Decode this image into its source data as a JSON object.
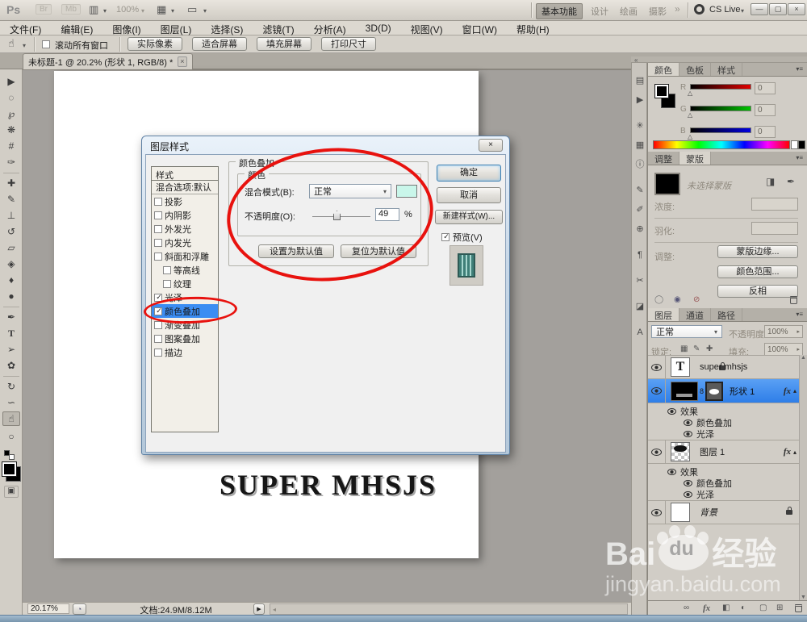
{
  "colors": {
    "ui_background": "#d6d2ca",
    "canvas_background": "#a3a09c",
    "selection_blue": "#2f7ee8",
    "annotation_red": "#e8120e",
    "overlay_swatch": "#c9f6ea"
  },
  "app_bar": {
    "logo": "Ps",
    "bridge": "Br",
    "mini_bridge": "Mb",
    "layout_glyph": "▥",
    "zoom_level": "100%",
    "view_glyph": "▦",
    "screen_glyph": "▭",
    "arrow": "▾",
    "workspaces": [
      "基本功能",
      "设计",
      "绘画",
      "摄影"
    ],
    "overflow": "»",
    "cs_live_label": "CS Live",
    "window_min": "—",
    "window_restore": "▢",
    "window_close": "×"
  },
  "menu_bar": {
    "items": [
      "文件(F)",
      "编辑(E)",
      "图像(I)",
      "图层(L)",
      "选择(S)",
      "滤镜(T)",
      "分析(A)",
      "3D(D)",
      "视图(V)",
      "窗口(W)",
      "帮助(H)"
    ]
  },
  "options_bar": {
    "tool_glyph": "☝",
    "scroll_all_label": "滚动所有窗口",
    "buttons": [
      "实际像素",
      "适合屏幕",
      "填充屏幕",
      "打印尺寸"
    ]
  },
  "document_tab": {
    "label": "未标题-1 @ 20.2% (形状 1, RGB/8) *",
    "close": "×"
  },
  "tools": [
    {
      "name": "move",
      "glyph": "▶"
    },
    {
      "name": "marquee",
      "glyph": "◌"
    },
    {
      "name": "lasso",
      "glyph": "℘"
    },
    {
      "name": "quick-selection",
      "glyph": "❋"
    },
    {
      "name": "crop",
      "glyph": "#"
    },
    {
      "name": "eyedropper",
      "glyph": "✑"
    },
    {
      "name": "healing-brush",
      "glyph": "✚"
    },
    {
      "name": "brush",
      "glyph": "✎"
    },
    {
      "name": "clone-stamp",
      "glyph": "⊥"
    },
    {
      "name": "history-brush",
      "glyph": "↺"
    },
    {
      "name": "eraser",
      "glyph": "▱"
    },
    {
      "name": "paint-bucket",
      "glyph": "◈"
    },
    {
      "name": "blur",
      "glyph": "♦"
    },
    {
      "name": "dodge",
      "glyph": "●"
    },
    {
      "name": "pen",
      "glyph": "✒"
    },
    {
      "name": "type",
      "glyph": "T"
    },
    {
      "name": "path-selection",
      "glyph": "➢"
    },
    {
      "name": "custom-shape",
      "glyph": "✿"
    },
    {
      "name": "rotate-3d",
      "glyph": "↻"
    },
    {
      "name": "orbit-3d",
      "glyph": "∽"
    },
    {
      "name": "hand",
      "glyph": "☝"
    },
    {
      "name": "zoom",
      "glyph": "○"
    }
  ],
  "dock_icons": [
    {
      "name": "history",
      "glyph": "▤"
    },
    {
      "name": "actions",
      "glyph": "▶"
    },
    {
      "name": "adjust-wheel",
      "glyph": "✳"
    },
    {
      "name": "image",
      "glyph": "▦"
    },
    {
      "name": "info",
      "glyph": "ⓘ"
    },
    {
      "name": "brush-presets",
      "glyph": "✎"
    },
    {
      "name": "tool-presets",
      "glyph": "✐"
    },
    {
      "name": "clone-source",
      "glyph": "⊕"
    },
    {
      "name": "paragraph",
      "glyph": "¶"
    },
    {
      "name": "annotations",
      "glyph": "✂"
    },
    {
      "name": "masks",
      "glyph": "◪"
    },
    {
      "name": "character",
      "glyph": "A"
    }
  ],
  "canvas": {
    "text": "SUPER MHSJS"
  },
  "dialog": {
    "title": "图层样式",
    "close": "×",
    "styles_header": "样式",
    "blending_default": "混合选项:默认",
    "styles": [
      {
        "label": "投影"
      },
      {
        "label": "内阴影"
      },
      {
        "label": "外发光"
      },
      {
        "label": "内发光"
      },
      {
        "label": "斜面和浮雕"
      },
      {
        "label": "等高线"
      },
      {
        "label": "纹理"
      },
      {
        "label": "光泽"
      },
      {
        "label": "颜色叠加"
      },
      {
        "label": "渐变叠加"
      },
      {
        "label": "图案叠加"
      },
      {
        "label": "描边"
      }
    ],
    "group_title": "颜色叠加",
    "color_group_title": "颜色",
    "blend_mode_label": "混合模式(B):",
    "blend_mode_value": "正常",
    "opacity_label": "不透明度(O):",
    "opacity_value": "49",
    "opacity_unit": "%",
    "set_default_button": "设置为默认值",
    "reset_default_button": "复位为默认值",
    "ok_button": "确定",
    "cancel_button": "取消",
    "new_style_button": "新建样式(W)...",
    "preview_label": "预览(V)"
  },
  "panels": {
    "color": {
      "tabs": [
        "颜色",
        "色板",
        "样式"
      ],
      "channels": [
        {
          "label": "R",
          "value": "0"
        },
        {
          "label": "G",
          "value": "0"
        },
        {
          "label": "B",
          "value": "0"
        }
      ]
    },
    "mask": {
      "tabs": [
        "调整",
        "蒙版"
      ],
      "no_mask_label": "未选择蒙版",
      "density_label": "浓度:",
      "feather_label": "羽化:",
      "refine_label": "调整:",
      "buttons": [
        "蒙版边缘...",
        "颜色范围...",
        "反相"
      ]
    },
    "layers": {
      "tabs": [
        "图层",
        "通道",
        "路径"
      ],
      "blend_mode": "正常",
      "opacity_label": "不透明度:",
      "opacity_value": "100%",
      "lock_label": "锁定:",
      "fill_label": "填充:",
      "fill_value": "100%",
      "rows": {
        "text_layer": "super mhsjs",
        "text_thumb": "T",
        "shape_layer": "形状 1",
        "layer1": "图层 1",
        "background": "背景",
        "effects_label": "效果",
        "effect_color_overlay": "颜色叠加",
        "effect_satin": "光泽",
        "fx": "fx"
      }
    }
  },
  "status_bar": {
    "zoom": "20.17%",
    "doc_info": "文档:24.9M/8.12M"
  },
  "watermark": {
    "brand_prefix": "Bai",
    "brand_du": "du",
    "brand_suffix": "经验",
    "url": "jingyan.baidu.com"
  },
  "icons": {
    "dropdown": "▾",
    "spinner": "▸",
    "menu": "▾≡",
    "collapse_dock": "«",
    "collapse_row": "▴",
    "slider_thumb": "△",
    "clock": "◔",
    "play": "▶",
    "scroll_left": "◂",
    "scroll_up": "▲",
    "scroll_down": "▼",
    "screen_mode": "▣",
    "link8": "8",
    "lock_row": [
      "▦",
      "✎",
      "✚"
    ],
    "mask_pixel": "◨",
    "mask_vector": "✒",
    "mask_footer": [
      "◯",
      "◉",
      "⊘"
    ],
    "layers_footer": [
      "∞",
      "fx",
      "◧",
      "◐",
      "▢",
      "⊞"
    ]
  }
}
